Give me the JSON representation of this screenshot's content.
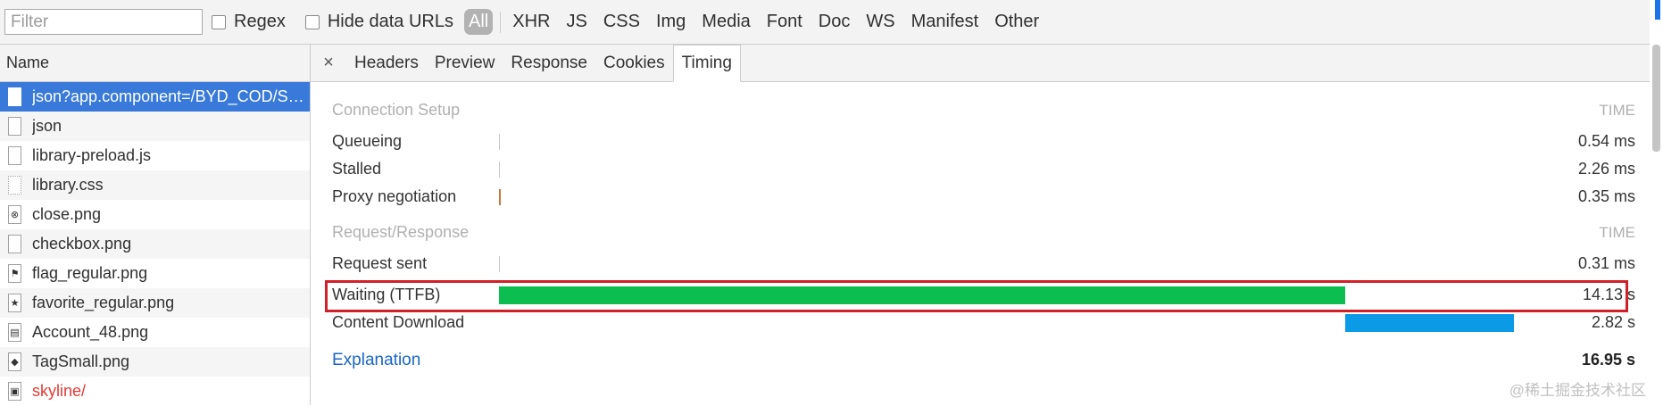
{
  "toolbar": {
    "filter_placeholder": "Filter",
    "regex_label": "Regex",
    "hide_data_urls_label": "Hide data URLs",
    "types": [
      "All",
      "XHR",
      "JS",
      "CSS",
      "Img",
      "Media",
      "Font",
      "Doc",
      "WS",
      "Manifest",
      "Other"
    ],
    "active_type": "All"
  },
  "list": {
    "header": "Name",
    "items": [
      {
        "name": "json?app.component=/BYD_COD/Sale...",
        "icon": "document-icon",
        "state": "selected"
      },
      {
        "name": "json",
        "icon": "document-icon",
        "state": ""
      },
      {
        "name": "library-preload.js",
        "icon": "document-icon",
        "state": ""
      },
      {
        "name": "library.css",
        "icon": "stylesheet-icon",
        "state": ""
      },
      {
        "name": "close.png",
        "icon": "close-image-icon",
        "state": ""
      },
      {
        "name": "checkbox.png",
        "icon": "document-icon",
        "state": ""
      },
      {
        "name": "flag_regular.png",
        "icon": "flag-icon",
        "state": ""
      },
      {
        "name": "favorite_regular.png",
        "icon": "star-icon",
        "state": ""
      },
      {
        "name": "Account_48.png",
        "icon": "account-image-icon",
        "state": ""
      },
      {
        "name": "TagSmall.png",
        "icon": "tag-icon",
        "state": ""
      },
      {
        "name": "skyline/",
        "icon": "image-icon",
        "state": "error"
      }
    ]
  },
  "tabs": {
    "close": "×",
    "items": [
      "Headers",
      "Preview",
      "Response",
      "Cookies",
      "Timing"
    ],
    "active": "Timing"
  },
  "timing": {
    "connection_setup": {
      "label": "Connection Setup",
      "time_header": "TIME",
      "rows": [
        {
          "label": "Queueing",
          "value": "0.54 ms"
        },
        {
          "label": "Stalled",
          "value": "2.26 ms"
        },
        {
          "label": "Proxy negotiation",
          "value": "0.35 ms"
        }
      ]
    },
    "request_response": {
      "label": "Request/Response",
      "time_header": "TIME",
      "rows": [
        {
          "label": "Request sent",
          "value": "0.31 ms"
        },
        {
          "label": "Waiting (TTFB)",
          "value": "14.13 s"
        },
        {
          "label": "Content Download",
          "value": "2.82 s"
        }
      ]
    },
    "explanation": "Explanation",
    "total": "16.95 s",
    "colors": {
      "waiting": "#0cbe4f",
      "download": "#0a9ae6",
      "proxy": "#c8783c",
      "highlight": "#d12027"
    }
  },
  "watermark": "@稀土掘金技术社区"
}
